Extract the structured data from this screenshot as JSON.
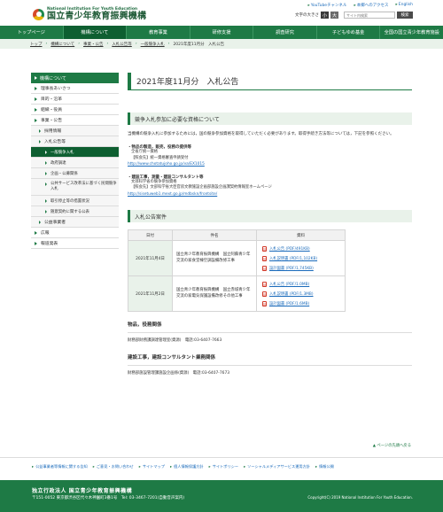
{
  "header": {
    "org_en": "National Institution For Youth Education",
    "org_jp": "国立青少年教育振興機構",
    "top_links": [
      "YouTubeチャンネル",
      "本郷へのアクセス",
      "English"
    ],
    "font_size_label": "文字の大きさ",
    "font_size_small": "小",
    "font_size_large": "大",
    "search_placeholder": "サイト内検索",
    "search_button": "検索"
  },
  "nav": {
    "items": [
      "トップページ",
      "機構について",
      "教育事業",
      "研修支援",
      "調査研究",
      "子どもゆめ基金",
      "全国の国立青少年教育施設"
    ]
  },
  "breadcrumb": [
    "トップ",
    "機構について",
    "事業・公告",
    "入札公告等",
    "一般競争入札",
    "2021年度11月分　入札公告"
  ],
  "sidebar": {
    "head": "機構について",
    "items": [
      "理事長あいさつ",
      "目的・沿革",
      "組織・役員",
      "事業・公告"
    ],
    "sub1": [
      "採用情報",
      "入札公告等"
    ],
    "selected": "一般競争入札",
    "sub2": [
      "政府調達",
      "企画・公募関係",
      "公共サービス改革法に基づく民間競争入札",
      "取引停止等の措置状況",
      "随意契約に関する公表"
    ],
    "sub_after": "公益事業者",
    "items_after": [
      "広報",
      "報道発表"
    ]
  },
  "main": {
    "title": "2021年度11月分　入札公告",
    "section1": "競争入札参加に必要な資格について",
    "para1": "当機構の競争入札に参加するためには，国の競争参加資格を取得していただく必要があります。取得手続き方法等については，下記を参照ください。",
    "block1_title": "・物品の製造，販売，役務の提供等",
    "block1_lines": [
      "全省庁統一資格",
      "【照会先】統一資格審査申請受付"
    ],
    "block1_link": "http://www.chotatujoho.go.jp/va/EX1015",
    "block2_title": "・建設工事，測量・建設コンサルタント等",
    "block2_lines": [
      "文部科学省の競争参加資格",
      "【照会先】文部科学省大臣官房文教施設企画部施設企画課契約情報室ホームページ"
    ],
    "block2_link": "http://sisetuweb1.mext.go.jp/mdbskn/frontsite/",
    "section2": "入札公告案件",
    "table_headers": [
      "日付",
      "件名",
      "資料"
    ],
    "rows": [
      {
        "date": "2021年11月4日",
        "name": "国立青少年教育振興機構　国立阿蘇青少年交流の家食堂棟空調設備改修工事",
        "files": [
          "入札公告 (PDF/491KB)",
          "入札説明書 (PDF/1,102KB)",
          "設計図書 (PDF/1,745KB)"
        ]
      },
      {
        "date": "2021年11月2日",
        "name": "国立青少年教育振興機構　国立赤城青少年交流の家電気保護設備改修その他工事",
        "files": [
          "入札公告 (PDF/1.0MB)",
          "入札説明書 (PDF/1.3MB)",
          "設計図書 (PDF/1.6MB)"
        ]
      }
    ],
    "rel1_title": "物品，役務関係",
    "rel1_line": "財務部財務課調達管理室(資源)　電話:03-6407-7663",
    "rel2_title": "建設工事，建設コンサルタント業務関係",
    "rel2_line": "財務部施設管理課施設企画係(資源)　電話:03-6407-7673",
    "to_top": "ページの先頭へ戻る"
  },
  "footer_links": [
    "公益事業者等情報に関する告知",
    "ご意見・お問い合わせ",
    "サイトマップ",
    "個人情報保護方針",
    "サイトポリシー",
    "ソーシャルメディアサービス運用方針",
    "情報公開"
  ],
  "footer": {
    "org": "独立行政法人 国立青少年教育振興機構",
    "address": "〒151-0052 東京都渋谷区代々木神園町3番1号　Tel: 03-3467-7201(自動音声案内)",
    "copyright": "Copyright(C) 2019 National Institution For Youth Education."
  },
  "colors": {
    "brand_green": "#1e7a45",
    "dark_green": "#0e5f31",
    "light_green": "#e9f2ea",
    "link_blue": "#1b6bbb",
    "pdf_red": "#d23a2a"
  }
}
